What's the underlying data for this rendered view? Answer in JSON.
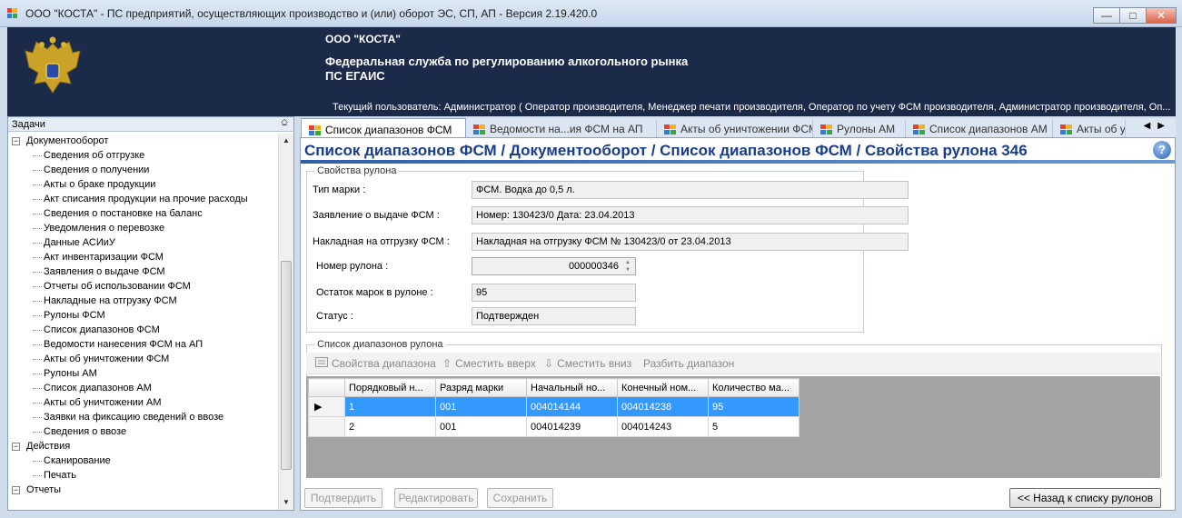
{
  "window": {
    "title": "ООО \"КОСТА\" - ПС предприятий, осуществляющих производство и (или) оборот ЭС, СП, АП - Версия 2.19.420.0",
    "controls": {
      "minimize": "—",
      "maximize": "□",
      "close": "✕"
    }
  },
  "banner": {
    "company": "ООО \"КОСТА\"",
    "agency": "Федеральная служба по регулированию алкогольного рынка",
    "system": "ПС ЕГАИС",
    "user": "Текущий пользователь: Администратор ( Оператор производителя, Менеджер печати производителя, Оператор по учету ФСМ производителя, Администратор производителя, Оп..."
  },
  "tasks": {
    "title": "Задачи",
    "pin": "⎐",
    "items": [
      {
        "label": "Документооборот",
        "level": 0,
        "toggle": "−"
      },
      {
        "label": "Сведения об отгрузке",
        "level": 1
      },
      {
        "label": "Сведения о получении",
        "level": 1
      },
      {
        "label": "Акты о браке продукции",
        "level": 1
      },
      {
        "label": "Акт списания продукции на прочие расходы",
        "level": 1
      },
      {
        "label": "Сведения о постановке на баланс",
        "level": 1
      },
      {
        "label": "Уведомления о перевозке",
        "level": 1
      },
      {
        "label": "Данные АСИиУ",
        "level": 1
      },
      {
        "label": "Акт инвентаризации ФСМ",
        "level": 1
      },
      {
        "label": "Заявления о выдаче ФСМ",
        "level": 1
      },
      {
        "label": "Отчеты об использовании ФСМ",
        "level": 1
      },
      {
        "label": "Накладные на отгрузку ФСМ",
        "level": 1
      },
      {
        "label": "Рулоны ФСМ",
        "level": 1
      },
      {
        "label": "Список диапазонов ФСМ",
        "level": 1
      },
      {
        "label": "Ведомости нанесения ФСМ на АП",
        "level": 1
      },
      {
        "label": "Акты об уничтожении ФСМ",
        "level": 1
      },
      {
        "label": "Рулоны АМ",
        "level": 1
      },
      {
        "label": "Список диапазонов АМ",
        "level": 1
      },
      {
        "label": "Акты об уничтожении АМ",
        "level": 1
      },
      {
        "label": "Заявки на фиксацию сведений о ввозе",
        "level": 1
      },
      {
        "label": "Сведения о ввозе",
        "level": 1
      },
      {
        "label": "Действия",
        "level": 0,
        "toggle": "−"
      },
      {
        "label": "Сканирование",
        "level": 1
      },
      {
        "label": "Печать",
        "level": 1
      },
      {
        "label": "Отчеты",
        "level": 0,
        "toggle": "−"
      }
    ],
    "scroll_up": "▲",
    "scroll_down": "▼"
  },
  "tabs": [
    {
      "label": "Список диапазонов ФСМ",
      "active": true
    },
    {
      "label": "Ведомости на...ия ФСМ на АП",
      "active": false
    },
    {
      "label": "Акты об уничтожении ФСМ",
      "active": false
    },
    {
      "label": "Рулоны АМ",
      "active": false
    },
    {
      "label": "Список диапазонов АМ",
      "active": false
    },
    {
      "label": "Акты об у",
      "active": false
    }
  ],
  "tab_nav": "◀▶",
  "page": {
    "headline": "Список диапазонов ФСМ / Документооборот / Список диапазонов ФСМ / Свойства рулона 346",
    "help": "?"
  },
  "properties": {
    "legend": "Свойства рулона",
    "mark_type_label": "Тип марки :",
    "mark_type_value": "ФСМ. Водка до 0,5 л.",
    "application_label": "Заявление о выдаче ФСМ :",
    "application_value": "Номер: 130423/0 Дата: 23.04.2013",
    "invoice_label": "Накладная на отгрузку ФСМ :",
    "invoice_value": "Накладная на отгрузку ФСМ № 130423/0 от 23.04.2013",
    "roll_number_label": "Номер рулона :",
    "roll_number_value": "000000346",
    "remaining_label": "Остаток марок в рулоне :",
    "remaining_value": "95",
    "status_label": "Статус :",
    "status_value": "Подтвержден"
  },
  "ranges": {
    "legend": "Список диапазонов рулона",
    "toolbar": {
      "properties": "Свойства диапазона",
      "move_up": "Сместить вверх",
      "move_down": "Сместить вниз",
      "split": "Разбить диапазон"
    },
    "columns": [
      "Порядковый н...",
      "Разряд марки",
      "Начальный но...",
      "Конечный ном...",
      "Количество ма..."
    ],
    "rows": [
      {
        "marker": "▶",
        "cells": [
          "1",
          "001",
          "004014144",
          "004014238",
          "95"
        ]
      },
      {
        "marker": "",
        "cells": [
          "2",
          "001",
          "004014239",
          "004014243",
          "5"
        ]
      }
    ]
  },
  "buttons": {
    "confirm": "Подтвердить",
    "edit": "Редактировать",
    "save": "Сохранить",
    "back": "<< Назад к списку рулонов"
  }
}
